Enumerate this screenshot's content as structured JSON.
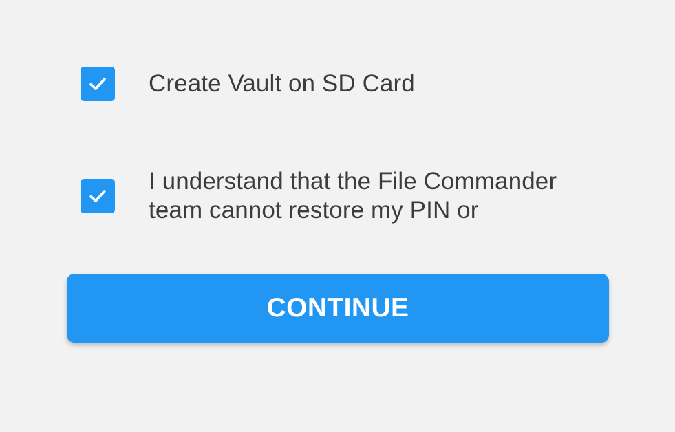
{
  "options": [
    {
      "checked": true,
      "label": "Create Vault on SD Card",
      "icon": "checkmark-icon"
    },
    {
      "checked": true,
      "label_lines": [
        "I understand that the File Commander",
        "team cannot restore my PIN or"
      ],
      "icon": "checkmark-icon"
    }
  ],
  "continue_button": {
    "label": "CONTINUE"
  },
  "colors": {
    "background": "#f2f2f2",
    "accent": "#2196f3",
    "text": "#3c3c3c",
    "button_text": "#ffffff"
  }
}
